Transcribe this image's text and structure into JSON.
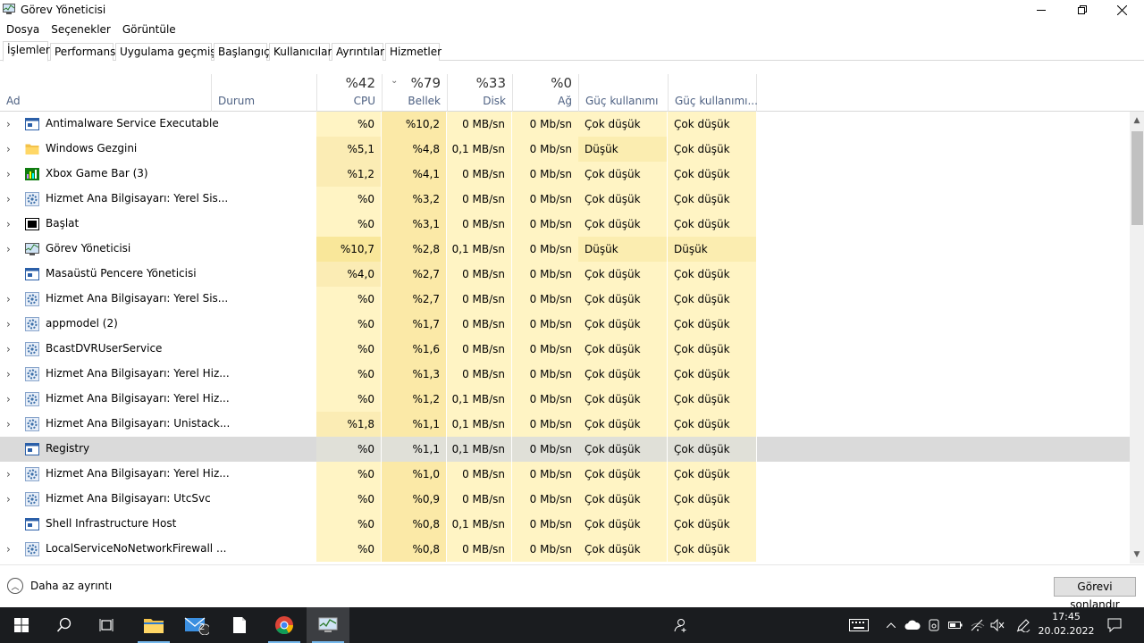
{
  "window": {
    "title": "Görev Yöneticisi",
    "controls": [
      "minimize-icon",
      "maximize-icon",
      "close-icon"
    ]
  },
  "menu": [
    "Dosya",
    "Seçenekler",
    "Görüntüle"
  ],
  "tabs": [
    "İşlemler",
    "Performans",
    "Uygulama geçmişi",
    "Başlangıç",
    "Kullanıcılar",
    "Ayrıntılar",
    "Hizmetler"
  ],
  "active_tab": "İşlemler",
  "columns": {
    "name": "Ad",
    "status": "Durum",
    "cpu": {
      "pct": "%42",
      "label": "CPU"
    },
    "memory": {
      "pct": "%79",
      "label": "Bellek"
    },
    "disk": {
      "pct": "%33",
      "label": "Disk"
    },
    "network": {
      "pct": "%0",
      "label": "Ağ"
    },
    "power": "Güç kullanımı",
    "power_trend": "Güç kullanımı..."
  },
  "processes": [
    {
      "name": "Antimalware Service Executable",
      "icon": "service-app-icon",
      "expandable": true,
      "cpu": "%0",
      "mem": "%10,2",
      "disk": "0 MB/sn",
      "net": "0 Mb/sn",
      "power": "Çok düşük",
      "trend": "Çok düşük"
    },
    {
      "name": "Windows Gezgini",
      "icon": "folder-icon",
      "expandable": true,
      "cpu": "%5,1",
      "mem": "%4,8",
      "disk": "0,1 MB/sn",
      "net": "0 Mb/sn",
      "power": "Düşük",
      "trend": "Çok düşük"
    },
    {
      "name": "Xbox Game Bar (3)",
      "icon": "xbox-game-bar-icon",
      "expandable": true,
      "cpu": "%1,2",
      "mem": "%4,1",
      "disk": "0 MB/sn",
      "net": "0 Mb/sn",
      "power": "Çok düşük",
      "trend": "Çok düşük"
    },
    {
      "name": "Hizmet Ana Bilgisayarı: Yerel Sis...",
      "icon": "gear-service-icon",
      "expandable": true,
      "cpu": "%0",
      "mem": "%3,2",
      "disk": "0 MB/sn",
      "net": "0 Mb/sn",
      "power": "Çok düşük",
      "trend": "Çok düşük"
    },
    {
      "name": "Başlat",
      "icon": "start-app-icon",
      "expandable": true,
      "cpu": "%0",
      "mem": "%3,1",
      "disk": "0 MB/sn",
      "net": "0 Mb/sn",
      "power": "Çok düşük",
      "trend": "Çok düşük"
    },
    {
      "name": "Görev Yöneticisi",
      "icon": "task-manager-icon",
      "expandable": true,
      "cpu": "%10,7",
      "mem": "%2,8",
      "disk": "0,1 MB/sn",
      "net": "0 Mb/sn",
      "power": "Düşük",
      "trend": "Düşük"
    },
    {
      "name": "Masaüstü Pencere Yöneticisi",
      "icon": "service-app-icon",
      "expandable": false,
      "cpu": "%4,0",
      "mem": "%2,7",
      "disk": "0 MB/sn",
      "net": "0 Mb/sn",
      "power": "Çok düşük",
      "trend": "Çok düşük"
    },
    {
      "name": "Hizmet Ana Bilgisayarı: Yerel Sis...",
      "icon": "gear-service-icon",
      "expandable": true,
      "cpu": "%0",
      "mem": "%2,7",
      "disk": "0 MB/sn",
      "net": "0 Mb/sn",
      "power": "Çok düşük",
      "trend": "Çok düşük"
    },
    {
      "name": "appmodel (2)",
      "icon": "gear-service-icon",
      "expandable": true,
      "cpu": "%0",
      "mem": "%1,7",
      "disk": "0 MB/sn",
      "net": "0 Mb/sn",
      "power": "Çok düşük",
      "trend": "Çok düşük"
    },
    {
      "name": "BcastDVRUserService",
      "icon": "gear-service-icon",
      "expandable": true,
      "cpu": "%0",
      "mem": "%1,6",
      "disk": "0 MB/sn",
      "net": "0 Mb/sn",
      "power": "Çok düşük",
      "trend": "Çok düşük"
    },
    {
      "name": "Hizmet Ana Bilgisayarı: Yerel Hiz...",
      "icon": "gear-service-icon",
      "expandable": true,
      "cpu": "%0",
      "mem": "%1,3",
      "disk": "0 MB/sn",
      "net": "0 Mb/sn",
      "power": "Çok düşük",
      "trend": "Çok düşük"
    },
    {
      "name": "Hizmet Ana Bilgisayarı: Yerel Hiz...",
      "icon": "gear-service-icon",
      "expandable": true,
      "cpu": "%0",
      "mem": "%1,2",
      "disk": "0,1 MB/sn",
      "net": "0 Mb/sn",
      "power": "Çok düşük",
      "trend": "Çok düşük"
    },
    {
      "name": "Hizmet Ana Bilgisayarı: Unistack...",
      "icon": "gear-service-icon",
      "expandable": true,
      "cpu": "%1,8",
      "mem": "%1,1",
      "disk": "0,1 MB/sn",
      "net": "0 Mb/sn",
      "power": "Çok düşük",
      "trend": "Çok düşük"
    },
    {
      "name": "Registry",
      "icon": "service-app-icon",
      "expandable": false,
      "selected": true,
      "cpu": "%0",
      "mem": "%1,1",
      "disk": "0,1 MB/sn",
      "net": "0 Mb/sn",
      "power": "Çok düşük",
      "trend": "Çok düşük"
    },
    {
      "name": "Hizmet Ana Bilgisayarı: Yerel Hiz...",
      "icon": "gear-service-icon",
      "expandable": true,
      "cpu": "%0",
      "mem": "%1,0",
      "disk": "0 MB/sn",
      "net": "0 Mb/sn",
      "power": "Çok düşük",
      "trend": "Çok düşük"
    },
    {
      "name": "Hizmet Ana Bilgisayarı: UtcSvc",
      "icon": "gear-service-icon",
      "expandable": true,
      "cpu": "%0",
      "mem": "%0,9",
      "disk": "0 MB/sn",
      "net": "0 Mb/sn",
      "power": "Çok düşük",
      "trend": "Çok düşük"
    },
    {
      "name": "Shell Infrastructure Host",
      "icon": "service-app-icon",
      "expandable": false,
      "cpu": "%0",
      "mem": "%0,8",
      "disk": "0,1 MB/sn",
      "net": "0 Mb/sn",
      "power": "Çok düşük",
      "trend": "Çok düşük"
    },
    {
      "name": "LocalServiceNoNetworkFirewall ...",
      "icon": "gear-service-icon",
      "expandable": true,
      "cpu": "%0",
      "mem": "%0,8",
      "disk": "0 MB/sn",
      "net": "0 Mb/sn",
      "power": "Çok düşük",
      "trend": "Çok düşük"
    }
  ],
  "footer": {
    "fewer_details": "Daha az ayrıntı",
    "end_task": "Görevi sonlandır"
  },
  "taskbar": {
    "mail_badge": "2",
    "time": "17:45",
    "date": "20.02.2022"
  }
}
